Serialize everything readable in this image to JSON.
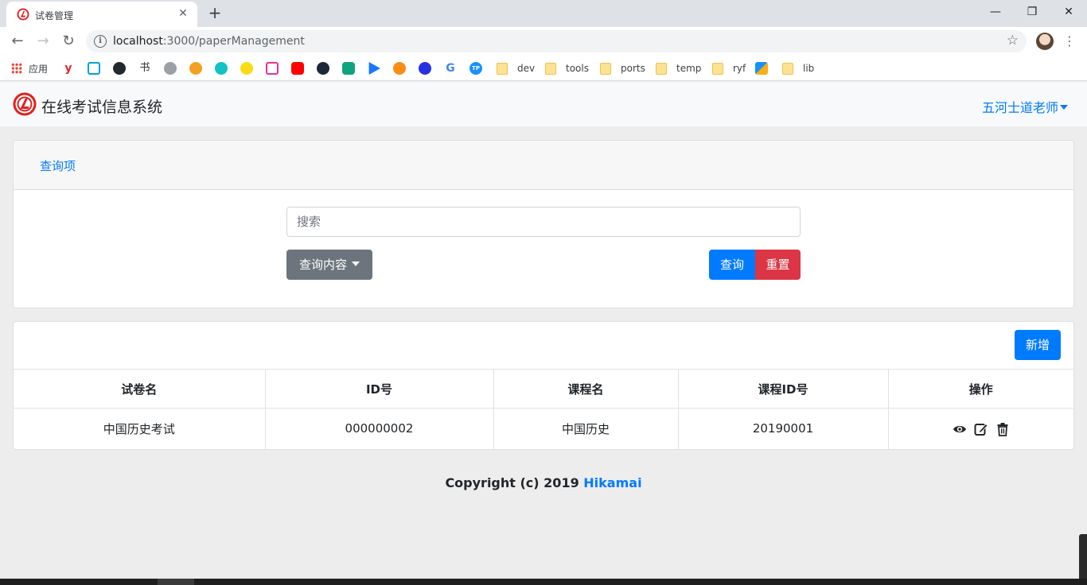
{
  "browser": {
    "tab_title": "试卷管理",
    "url_host": "localhost",
    "url_port": ":3000",
    "url_path": "/paperManagement",
    "bookmarks": [
      {
        "label": "应用",
        "icon": "apps-grid-icon"
      },
      {
        "label": "dev",
        "icon": "folder-icon"
      },
      {
        "label": "tools",
        "icon": "folder-icon"
      },
      {
        "label": "ports",
        "icon": "folder-icon"
      },
      {
        "label": "temp",
        "icon": "folder-icon"
      },
      {
        "label": "ryf",
        "icon": "folder-icon"
      },
      {
        "label": "lib",
        "icon": "folder-icon"
      }
    ]
  },
  "navbar": {
    "brand": "在线考试信息系统",
    "user": "五河士道老师"
  },
  "query_card": {
    "title": "查询项",
    "search_placeholder": "搜索",
    "dropdown_label": "查询内容",
    "query_button": "查询",
    "reset_button": "重置"
  },
  "table_card": {
    "add_button": "新增",
    "columns": [
      "试卷名",
      "ID号",
      "课程名",
      "课程ID号",
      "操作"
    ],
    "rows": [
      {
        "paper_name": "中国历史考试",
        "id": "000000002",
        "course_name": "中国历史",
        "course_id": "20190001",
        "actions": [
          "view-icon",
          "edit-icon",
          "delete-icon"
        ]
      }
    ]
  },
  "footer": {
    "prefix": "Copyright (c) 2019",
    "brand": "Hikamai"
  },
  "colors": {
    "primary": "#007bff",
    "danger": "#dc3545",
    "secondary": "#6c757d"
  }
}
